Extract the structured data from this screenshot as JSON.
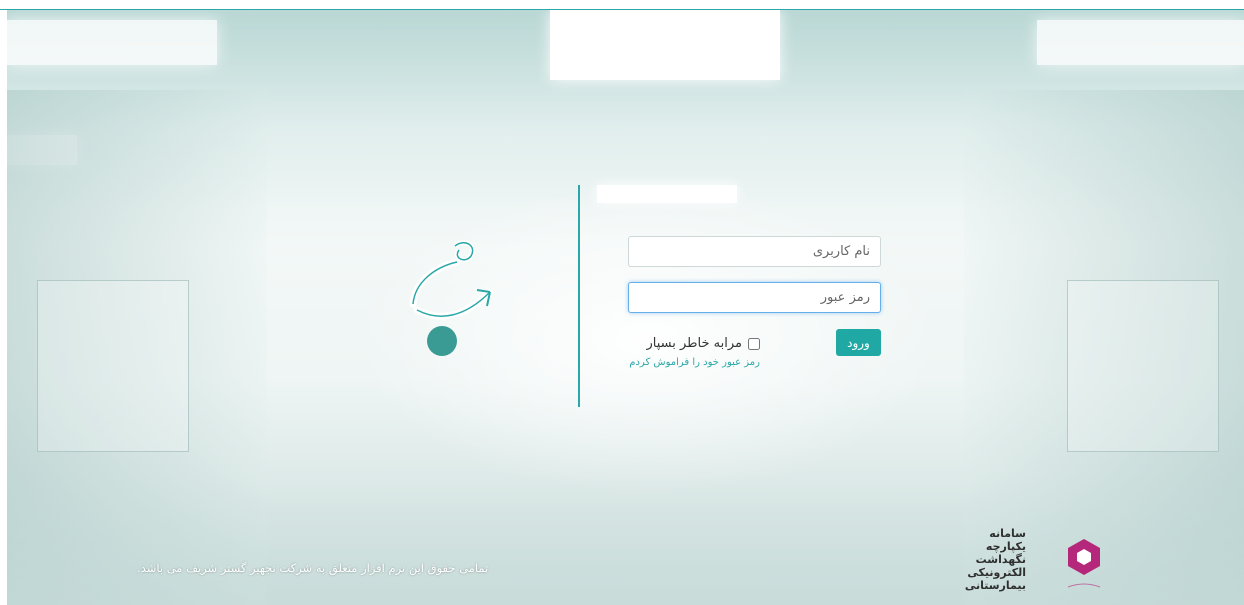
{
  "login": {
    "username_placeholder": "نام کاربری",
    "password_placeholder": "رمز عبور",
    "remember_label": "مرابه خاطر بسپار",
    "login_button": "ورود",
    "forgot_password_link": "رمز عبور خود را فراموش کردم"
  },
  "footer": {
    "copyright": "تمامی حقوق این نرم افزار متعلق به شرکت تجهیز گستر شریف می باشد.",
    "system_name_lines": [
      "سامانه",
      "یکپارچه",
      "نگهداشت",
      "الکترونیکی",
      "بیمارستانی"
    ]
  },
  "colors": {
    "accent": "#20a8a4",
    "logo": "#b4277a"
  },
  "icons": {
    "brand_symbol": "arrow-circle-brand-icon",
    "company_logo": "hexagon-logo-icon"
  }
}
